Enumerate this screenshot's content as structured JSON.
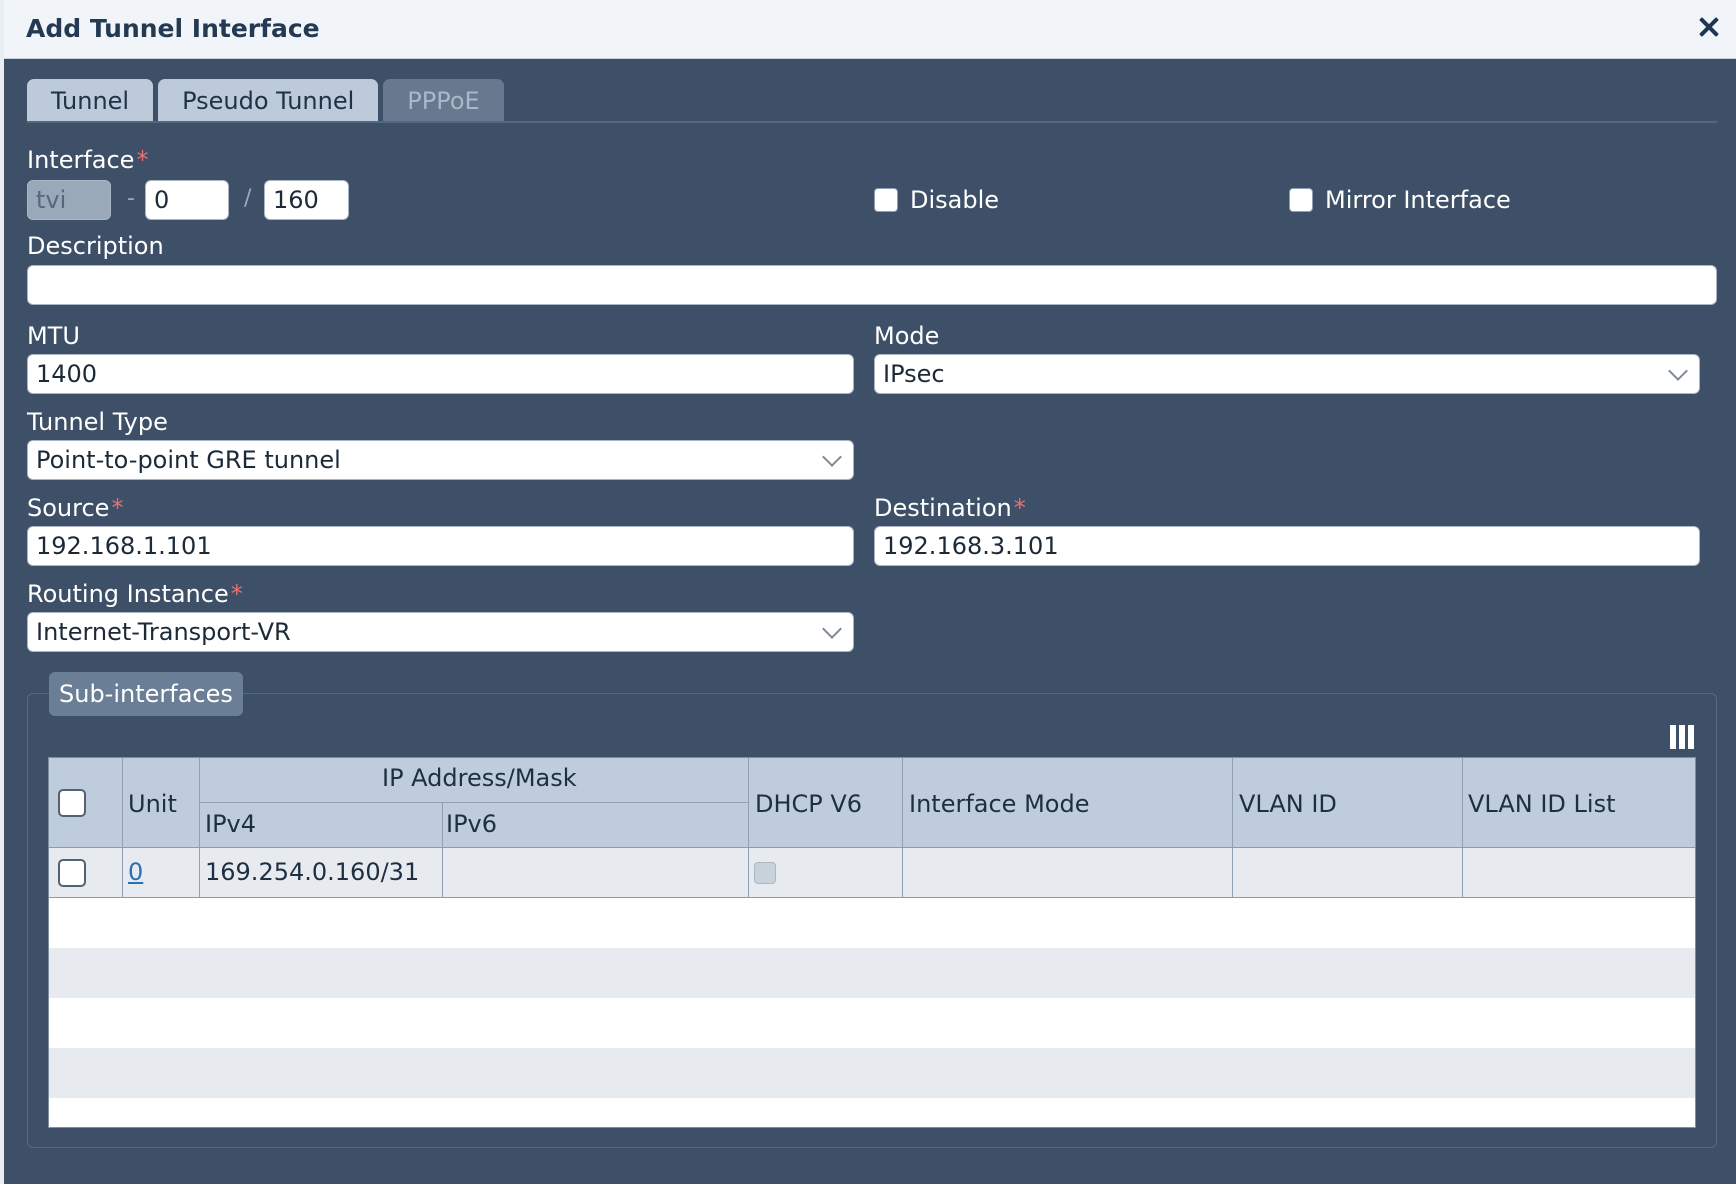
{
  "dialog": {
    "title": "Add Tunnel Interface"
  },
  "tabs": [
    {
      "label": "Tunnel"
    },
    {
      "label": "Pseudo Tunnel"
    },
    {
      "label": "PPPoE"
    }
  ],
  "form": {
    "interface_label": "Interface",
    "required_mark": "*",
    "interface_prefix": "tvi",
    "dash": "-",
    "slash": "/",
    "interface_num": "0",
    "interface_sub": "160",
    "disable_label": "Disable",
    "mirror_label": "Mirror Interface",
    "description_label": "Description",
    "description_value": "",
    "mtu_label": "MTU",
    "mtu_value": "1400",
    "mode_label": "Mode",
    "mode_value": "IPsec",
    "tunnel_type_label": "Tunnel Type",
    "tunnel_type_value": "Point-to-point GRE tunnel",
    "source_label": "Source",
    "source_value": "192.168.1.101",
    "destination_label": "Destination",
    "destination_value": "192.168.3.101",
    "routing_label": "Routing Instance",
    "routing_value": "Internet-Transport-VR"
  },
  "subinterfaces": {
    "legend": "Sub-interfaces",
    "columns": {
      "unit": "Unit",
      "ip_group": "IP Address/Mask",
      "ipv4": "IPv4",
      "ipv6": "IPv6",
      "dhcp_v6": "DHCP V6",
      "interface_mode": "Interface Mode",
      "vlan_id": "VLAN ID",
      "vlan_id_list": "VLAN ID List"
    },
    "rows": [
      {
        "unit": "0",
        "ipv4": "169.254.0.160/31",
        "ipv6": "",
        "interface_mode": "",
        "vlan_id": "",
        "vlan_id_list": ""
      }
    ]
  }
}
